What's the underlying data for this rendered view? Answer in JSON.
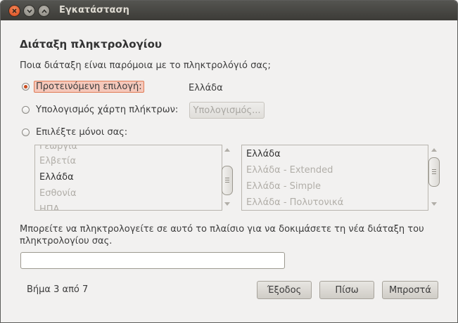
{
  "window": {
    "title": "Εγκατάσταση"
  },
  "page": {
    "heading": "Διάταξη πληκτρολογίου",
    "question": "Ποια διάταξη είναι παρόμοια με το πληκτρολόγιό σας;"
  },
  "options": {
    "suggested_label": "Προτεινόμενη επιλογή:",
    "suggested_value": "Ελλάδα",
    "guess_label": "Υπολογισμός χάρτη πλήκτρων:",
    "guess_button": "Υπολογισμός...",
    "manual_label": "Επιλέξτε μόνοι σας:"
  },
  "countries": [
    "Γεωργία",
    "Ελβετία",
    "Ελλάδα",
    "Εσθονία",
    "ΗΠΑ"
  ],
  "variants": [
    "Ελλάδα",
    "Ελλάδα - Extended",
    "Ελλάδα - Simple",
    "Ελλάδα - Πολυτονικά"
  ],
  "test": {
    "hint": "Μπορείτε να πληκτρολογείτε σε αυτό το πλαίσιο για να δοκιμάσετε τη νέα διάταξη του πληκτρολογίου σας.",
    "value": "",
    "placeholder": ""
  },
  "footer": {
    "step": "Βήμα 3 από 7",
    "quit": "Έξοδος",
    "back": "Πίσω",
    "forward": "Μπροστά"
  },
  "colors": {
    "accent": "#c94a1d",
    "titlebar": "#3c3b37"
  }
}
